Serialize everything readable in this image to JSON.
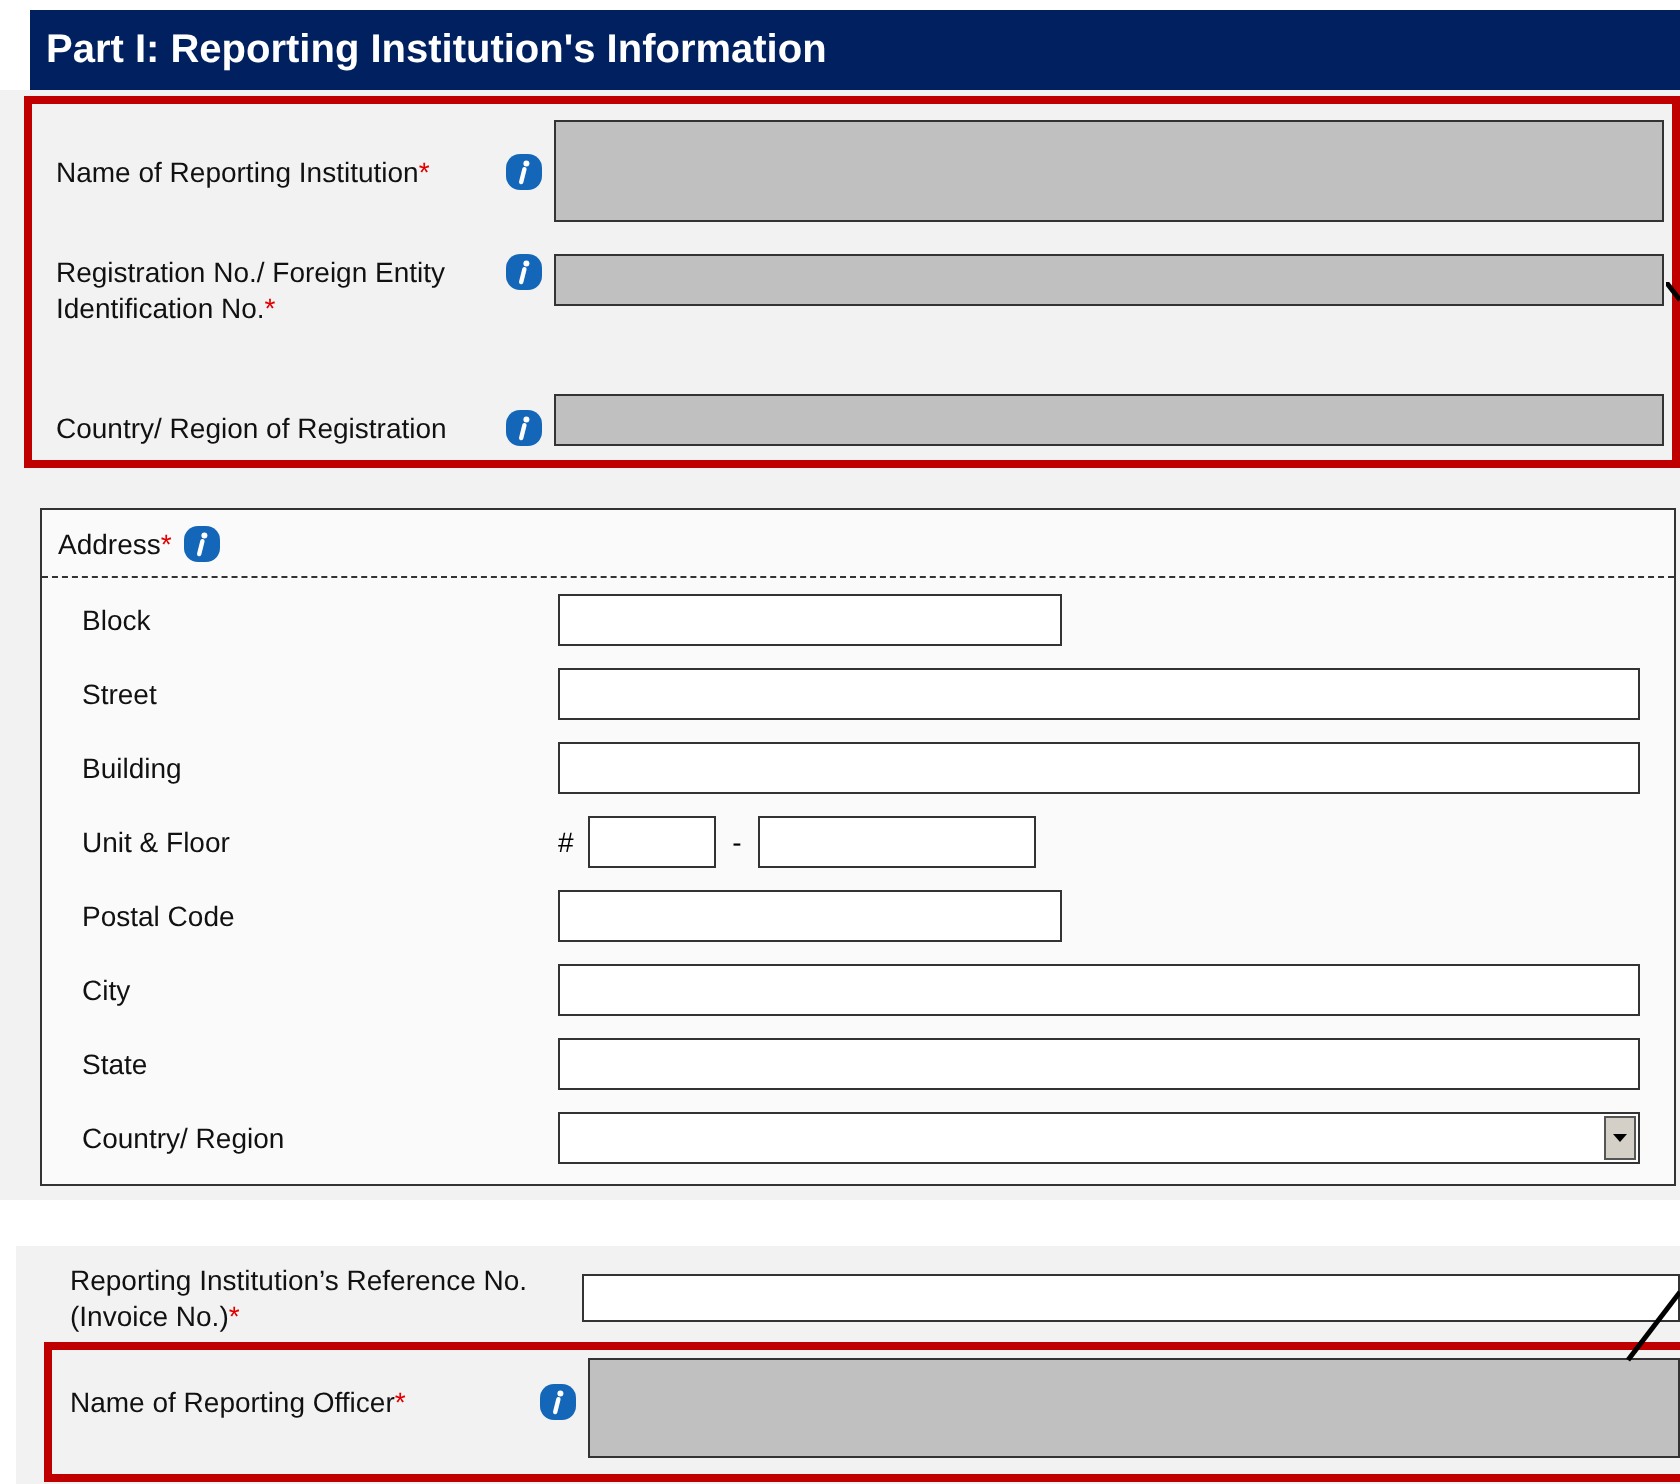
{
  "header": {
    "title": "Part I: Reporting Institution's Information"
  },
  "institution": {
    "highlighted": true,
    "fields": [
      {
        "label": "Name of Reporting Institution",
        "required_mark": "*",
        "info": true,
        "disabled": true,
        "kind": "tall"
      },
      {
        "label": "Registration No./ Foreign Entity Identification No.",
        "required_mark": "*",
        "info": true,
        "disabled": true,
        "kind": "normal"
      },
      {
        "label": "Country/ Region of Registration",
        "info": true,
        "disabled": true,
        "kind": "normal"
      }
    ]
  },
  "address": {
    "label": "Address",
    "required_mark": "*",
    "info": true,
    "rows": [
      {
        "label": "Block",
        "kind": "short"
      },
      {
        "label": "Street",
        "kind": "long"
      },
      {
        "label": "Building",
        "kind": "long"
      },
      {
        "label": "Unit & Floor",
        "kind": "unit",
        "prefix": "#",
        "separator": "-"
      },
      {
        "label": "Postal Code",
        "kind": "short"
      },
      {
        "label": "City",
        "kind": "long"
      },
      {
        "label": "State",
        "kind": "long"
      },
      {
        "label": "Country/ Region",
        "kind": "select"
      }
    ]
  },
  "reference": {
    "label": "Reporting Institution’s Reference No. (Invoice No.)",
    "required_mark": "*",
    "info": false,
    "disabled": false
  },
  "officer": {
    "label": "Name of Reporting Officer",
    "required_mark": "*",
    "info": true,
    "disabled": true,
    "highlighted": true
  }
}
